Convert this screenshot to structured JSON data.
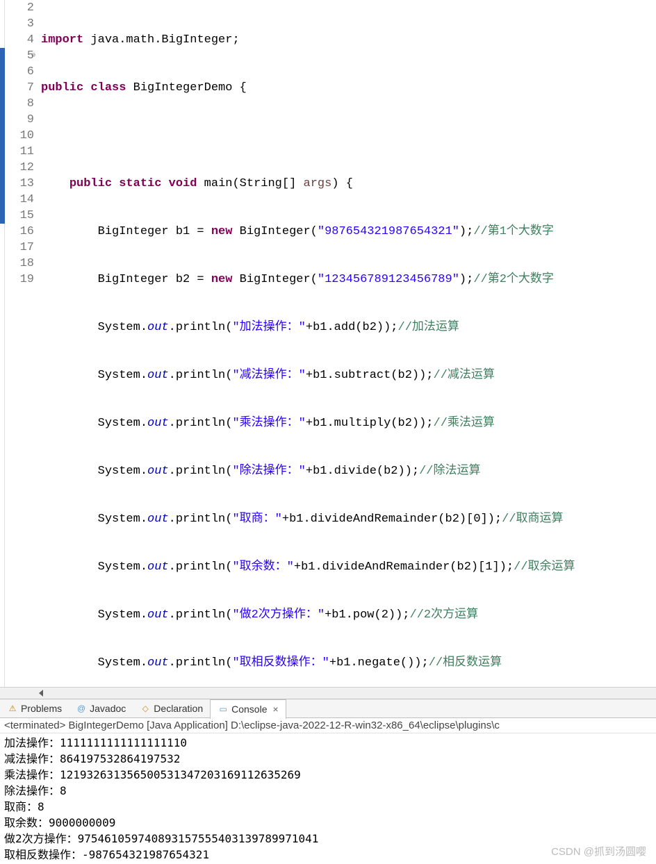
{
  "code": {
    "lines": [
      {
        "n": 2,
        "bp": false
      },
      {
        "n": 3,
        "bp": false
      },
      {
        "n": 4,
        "bp": false
      },
      {
        "n": 5,
        "bp": true,
        "override": true
      },
      {
        "n": 6,
        "bp": true
      },
      {
        "n": 7,
        "bp": true
      },
      {
        "n": 8,
        "bp": true
      },
      {
        "n": 9,
        "bp": true
      },
      {
        "n": 10,
        "bp": true
      },
      {
        "n": 11,
        "bp": true
      },
      {
        "n": 12,
        "bp": true
      },
      {
        "n": 13,
        "bp": true
      },
      {
        "n": 14,
        "bp": true
      },
      {
        "n": 15,
        "bp": true
      },
      {
        "n": 16,
        "bp": false
      },
      {
        "n": 17,
        "bp": false
      },
      {
        "n": 18,
        "bp": false
      },
      {
        "n": 19,
        "bp": false,
        "hl": true
      }
    ],
    "kw_import": "import",
    "kw_public": "public",
    "kw_class": "class",
    "kw_static": "static",
    "kw_void": "void",
    "kw_new": "new",
    "pkg": " java.math.BigInteger;",
    "classname": " BigIntegerDemo {",
    "main_sig_a": " main(String[] ",
    "main_sig_args": "args",
    "main_sig_b": ") {",
    "b1_a": "        BigInteger b1 = ",
    "b1_b": " BigInteger(",
    "b1_str": "\"987654321987654321\"",
    "b1_c": ");",
    "b1_cmt": "//第1个大数字",
    "b2_a": "        BigInteger b2 = ",
    "b2_b": " BigInteger(",
    "b2_str": "\"123456789123456789\"",
    "b2_c": ");",
    "b2_cmt": "//第2个大数字",
    "sys_a": "        System.",
    "out": "out",
    "println": ".println(",
    "add_str": "\"加法操作：\"",
    "add_op": "+b1.add(b2));",
    "add_cmt": "//加法运算",
    "sub_str": "\"减法操作：\"",
    "sub_op": "+b1.subtract(b2));",
    "sub_cmt": "//减法运算",
    "mul_str": "\"乘法操作：\"",
    "mul_op": "+b1.multiply(b2));",
    "mul_cmt": "//乘法运算",
    "div_str": "\"除法操作：\"",
    "div_op": "+b1.divide(b2));",
    "div_cmt": "//除法运算",
    "quo_str": "\"取商：\"",
    "quo_op": "+b1.divideAndRemainder(b2)[0]);",
    "quo_cmt": "//取商运算",
    "rem_str": "\"取余数：\"",
    "rem_op": "+b1.divideAndRemainder(b2)[1]);",
    "rem_cmt": "//取余运算",
    "pow_str": "\"做2次方操作：\"",
    "pow_op": "+b1.pow(2));",
    "pow_cmt": "//2次方运算",
    "neg_str": "\"取相反数操作：\"",
    "neg_op": "+b1.negate());",
    "neg_cmt": "//相反数运算",
    "close_method": "    }",
    "close_class": "}"
  },
  "tabs": {
    "problems": "Problems",
    "javadoc": "Javadoc",
    "declaration": "Declaration",
    "console": "Console"
  },
  "console": {
    "info": "<terminated> BigIntegerDemo [Java Application] D:\\eclipse-java-2022-12-R-win32-x86_64\\eclipse\\plugins\\c",
    "lines": [
      "加法操作：1111111111111111110",
      "减法操作：864197532864197532",
      "乘法操作：121932631356500531347203169112635269",
      "除法操作：8",
      "取商：8",
      "取余数：9000000009",
      "做2次方操作：975461059740893157555403139789971041",
      "取相反数操作：-987654321987654321"
    ]
  },
  "watermark": "CSDN @抓到汤圆嘤"
}
